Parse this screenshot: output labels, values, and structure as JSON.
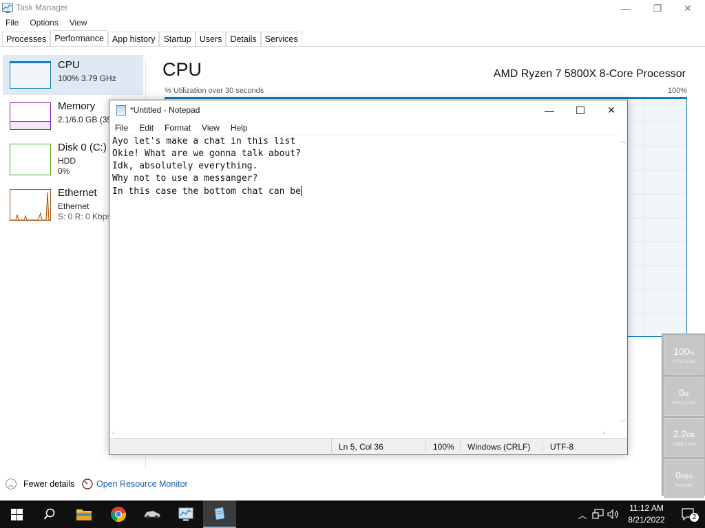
{
  "task_manager": {
    "title": "Task Manager",
    "window_controls": {
      "minimize": "—",
      "maximize": "❐",
      "close": "✕"
    },
    "menu": [
      "File",
      "Options",
      "View"
    ],
    "tabs": [
      "Processes",
      "Performance",
      "App history",
      "Startup",
      "Users",
      "Details",
      "Services"
    ],
    "active_tab": "Performance",
    "sidebar": [
      {
        "name": "CPU",
        "line1": "100% 3.79 GHz",
        "line2": "",
        "color": "#117dbb",
        "selected": true
      },
      {
        "name": "Memory",
        "line1": "2.1/6.0 GB (35",
        "line2": "",
        "color": "#8b12ae",
        "selected": false
      },
      {
        "name": "Disk 0 (C:)",
        "line1": "HDD",
        "line2": "0%",
        "color": "#4da60c",
        "selected": false
      },
      {
        "name": "Ethernet",
        "line1": "Ethernet",
        "line2": "S: 0 R: 0 Kbps",
        "color": "#a74f01",
        "selected": false
      }
    ],
    "detail": {
      "title": "CPU",
      "model": "AMD Ryzen 7 5800X 8-Core Processor",
      "util_label": "% Utilization over 30 seconds",
      "max_label": "100%",
      "utilization_percent": 100
    },
    "footer": {
      "fewer_details": "Fewer details",
      "resource_monitor": "Open Resource Monitor"
    }
  },
  "hw_widget": [
    {
      "value": "100",
      "unit": "%",
      "caption": "CPU Load"
    },
    {
      "value": "0",
      "unit": "%",
      "caption": "GPU Load"
    },
    {
      "value": "2.2",
      "unit": "GB",
      "caption": "RAM Load"
    },
    {
      "value": "0",
      "unit": "KB/s",
      "caption": "Network"
    }
  ],
  "notepad": {
    "title": "*Untitled - Notepad",
    "window_controls": {
      "minimize": "—",
      "maximize": "☐",
      "close": "✕"
    },
    "menu": [
      "File",
      "Edit",
      "Format",
      "View",
      "Help"
    ],
    "lines": [
      "Ayo let's make a chat in this list",
      "Okie! What are we gonna talk about?",
      "Idk, absolutely everything.",
      "Why not to use a messanger?",
      "In this case the bottom chat can be"
    ],
    "status": {
      "position": "Ln 5, Col 36",
      "zoom": "100%",
      "line_endings": "Windows (CRLF)",
      "encoding": "UTF-8"
    }
  },
  "taskbar": {
    "icons": [
      "windows-start-icon",
      "search-icon",
      "file-explorer-icon",
      "chrome-icon",
      "car-app-icon",
      "task-manager-icon",
      "notepad-icon"
    ],
    "active": "notepad-icon",
    "clock_time": "11:12 AM",
    "clock_date": "8/21/2022",
    "notification_count": "2"
  }
}
